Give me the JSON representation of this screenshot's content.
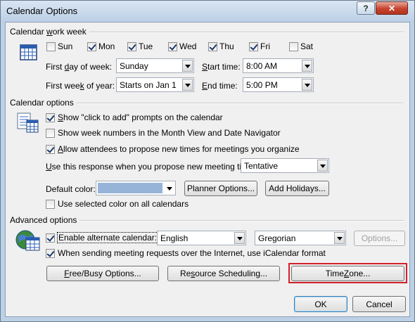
{
  "window": {
    "title": "Calendar Options",
    "help_glyph": "?",
    "close_glyph": "✕"
  },
  "work_week": {
    "title_prefix": "Calendar ",
    "title_u": "w",
    "title_suffix": "ork week",
    "days": [
      {
        "label": "Sun",
        "checked": false
      },
      {
        "label": "Mon",
        "checked": true
      },
      {
        "label": "Tue",
        "checked": true
      },
      {
        "label": "Wed",
        "checked": true
      },
      {
        "label": "Thu",
        "checked": true
      },
      {
        "label": "Fri",
        "checked": true
      },
      {
        "label": "Sat",
        "checked": false
      }
    ],
    "first_day_label_a": "First ",
    "first_day_label_u": "d",
    "first_day_label_b": "ay of week:",
    "first_day_value": "Sunday",
    "start_time_label_u": "S",
    "start_time_label_b": "tart time:",
    "start_time_value": "8:00 AM",
    "first_week_label_a": "First wee",
    "first_week_label_u": "k",
    "first_week_label_b": " of year:",
    "first_week_value": "Starts on Jan 1",
    "end_time_label_u": "E",
    "end_time_label_b": "nd time:",
    "end_time_value": "5:00 PM"
  },
  "calendar_options": {
    "title": "Calendar options",
    "click_to_add_u": "S",
    "click_to_add_b": "how \"click to add\" prompts on the calendar",
    "click_to_add_checked": true,
    "week_numbers": "Show week numbers in the Month View and Date Navigator",
    "week_numbers_checked": false,
    "allow_propose_u": "A",
    "allow_propose_b": "llow attendees to propose new times for meetings you organize",
    "allow_propose_checked": true,
    "response_label_u": "U",
    "response_label_b": "se this response when you propose new meeting times:",
    "response_value": "Tentative",
    "default_color_label": "Default color:",
    "default_color": "#96b4d8",
    "planner_button": "Planner Options...",
    "add_holidays_button": "Add Holidays...",
    "use_selected_color": "Use selected color on all calendars",
    "use_selected_color_checked": false
  },
  "advanced": {
    "title": "Advanced options",
    "alt_cal_label": "Enable alternate calendar:",
    "alt_cal_checked": true,
    "language_value": "English",
    "calendar_type_value": "Gregorian",
    "options_button": "Options...",
    "icalendar_label": "When sending meeting requests over the Internet, use iCalendar format",
    "icalendar_checked": true,
    "free_busy_u": "F",
    "free_busy_b": "ree/Busy Options...",
    "resource_a": "Re",
    "resource_u": "s",
    "resource_b": "ource Scheduling...",
    "time_zone_a": "Time ",
    "time_zone_u": "Z",
    "time_zone_b": "one..."
  },
  "footer": {
    "ok_button": "OK",
    "cancel_button": "Cancel"
  },
  "colors": {
    "highlight": "#d2202a",
    "title_bar": "#bcd0e6"
  }
}
